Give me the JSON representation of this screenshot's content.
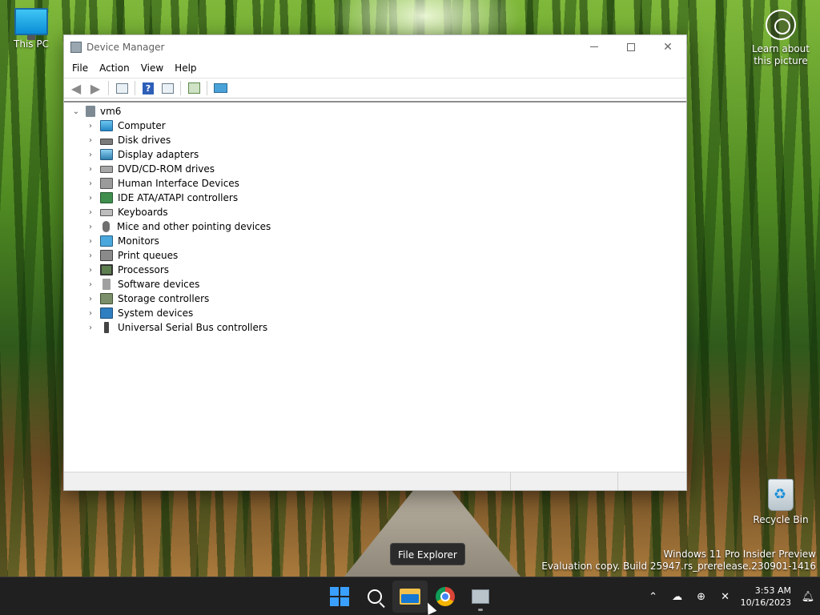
{
  "desktop": {
    "icons": {
      "this_pc": "This PC",
      "learn_line1": "Learn about",
      "learn_line2": "this picture",
      "recycle_bin": "Recycle Bin"
    },
    "watermark_line1": "Windows 11 Pro Insider Preview",
    "watermark_line2": "Evaluation copy. Build 25947.rs_prerelease.230901-1416",
    "tooltip": "File Explorer"
  },
  "window": {
    "title": "Device Manager",
    "controls": {
      "minimize": "",
      "maximize": "",
      "close": "✕"
    },
    "menu": [
      "File",
      "Action",
      "View",
      "Help"
    ],
    "tree": {
      "root": "vm6",
      "categories": [
        "Computer",
        "Disk drives",
        "Display adapters",
        "DVD/CD-ROM drives",
        "Human Interface Devices",
        "IDE ATA/ATAPI controllers",
        "Keyboards",
        "Mice and other pointing devices",
        "Monitors",
        "Print queues",
        "Processors",
        "Software devices",
        "Storage controllers",
        "System devices",
        "Universal Serial Bus controllers"
      ]
    }
  },
  "taskbar": {
    "clock_time": "3:53 AM",
    "clock_date": "10/16/2023"
  },
  "colors": {
    "taskbar": "#202020",
    "accent": "#3aa0ff"
  }
}
